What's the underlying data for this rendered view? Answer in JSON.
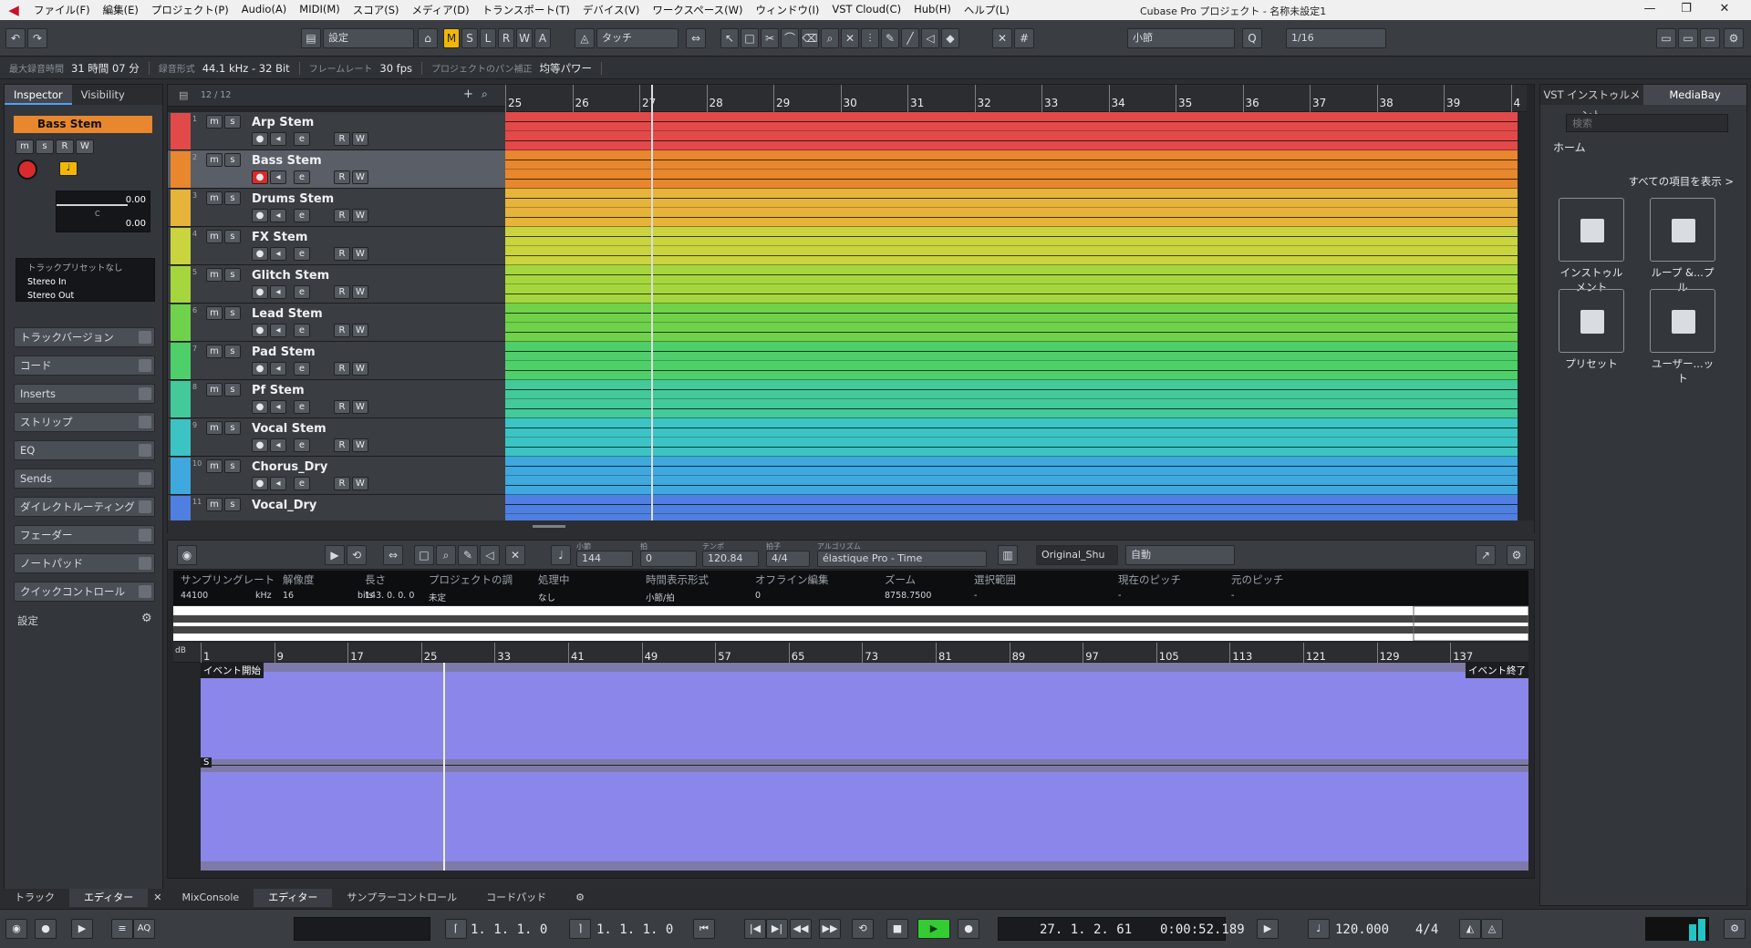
{
  "menubar": {
    "items": [
      "ファイル(F)",
      "編集(E)",
      "プロジェクト(P)",
      "Audio(A)",
      "MIDI(M)",
      "スコア(S)",
      "メディア(D)",
      "トランスポート(T)",
      "デバイス(V)",
      "ワークスペース(W)",
      "ウィンドウ(I)",
      "VST Cloud(C)",
      "Hub(H)",
      "ヘルプ(L)"
    ],
    "window_title": "Cubase Pro プロジェクト - 名称未設定1"
  },
  "toolbar": {
    "preset": "設定",
    "automation_mode": "タッチ",
    "grid_type": "小節",
    "quantize": "1/16",
    "msl": [
      "M",
      "S",
      "L",
      "R",
      "W",
      "A"
    ]
  },
  "status": {
    "rec_time_label": "最大録音時間",
    "rec_time": "31 時間 07 分",
    "rec_format_label": "録音形式",
    "rec_format": "44.1 kHz - 32 Bit",
    "frame_rate_label": "フレームレート",
    "frame_rate": "30 fps",
    "pan_label": "プロジェクトのパン補正",
    "pan": "均等パワー"
  },
  "inspector": {
    "tabs": [
      "Inspector",
      "Visibility"
    ],
    "track_number": "2",
    "track_name": "Bass Stem",
    "volume": "0.00",
    "pan": "0.00",
    "pan_center": "C",
    "track_preset": "トラックプリセットなし",
    "input": "Stereo In",
    "output": "Stereo Out",
    "sections": [
      "トラックバージョン",
      "コード",
      "Inserts",
      "ストリップ",
      "EQ",
      "Sends",
      "ダイレクトルーティング",
      "フェーダー",
      "ノートパッド",
      "クイックコントロール"
    ],
    "settings_label": "設定"
  },
  "project": {
    "track_count": "12 / 12",
    "tracks": [
      {
        "num": "1",
        "name": "Arp Stem",
        "color": "#e24a4a"
      },
      {
        "num": "2",
        "name": "Bass Stem",
        "color": "#e8872e"
      },
      {
        "num": "3",
        "name": "Drums Stem",
        "color": "#e6b43a"
      },
      {
        "num": "4",
        "name": "FX Stem",
        "color": "#c9d43e"
      },
      {
        "num": "5",
        "name": "Glitch Stem",
        "color": "#a6d63e"
      },
      {
        "num": "6",
        "name": "Lead Stem",
        "color": "#6fd24a"
      },
      {
        "num": "7",
        "name": "Pad Stem",
        "color": "#4fcf6a"
      },
      {
        "num": "8",
        "name": "Pf Stem",
        "color": "#43c99a"
      },
      {
        "num": "9",
        "name": "Vocal Stem",
        "color": "#3cc4c4"
      },
      {
        "num": "10",
        "name": "Chorus_Dry",
        "color": "#3fa8de"
      },
      {
        "num": "11",
        "name": "Vocal_Dry",
        "color": "#4f7fe0"
      }
    ],
    "ruler": [
      "25",
      "26",
      "27",
      "28",
      "29",
      "30",
      "31",
      "32",
      "33",
      "34",
      "35",
      "36",
      "37",
      "38",
      "39",
      "4"
    ],
    "track_buttons": [
      "m",
      "s",
      "R",
      "W"
    ]
  },
  "editor": {
    "bar_label": "小節",
    "bar_value": "144",
    "beat_label": "拍",
    "beat_value": "0",
    "tempo_label": "テンポ",
    "tempo_value": "120.84",
    "sig_label": "拍子",
    "sig_value": "4/4",
    "algo_label": "アルゴリズム",
    "algo_value": "élastique Pro - Time",
    "shuffle": "Original_Shu",
    "auto": "自動",
    "info_cols": [
      {
        "h": "サンプリングレート",
        "v": "44100",
        "u": "kHz"
      },
      {
        "h": "解像度",
        "v": "16",
        "u": "bits"
      },
      {
        "h": "長さ",
        "v": "143. 0. 0. 0",
        "u": ""
      },
      {
        "h": "プロジェクトの調",
        "v": "未定",
        "u": ""
      },
      {
        "h": "処理中",
        "v": "なし",
        "u": ""
      },
      {
        "h": "時間表示形式",
        "v": "小節/拍",
        "u": ""
      },
      {
        "h": "オフライン編集",
        "v": "0",
        "u": ""
      },
      {
        "h": "ズーム",
        "v": "8758.7500",
        "u": ""
      },
      {
        "h": "選択範囲",
        "v": "-",
        "u": ""
      },
      {
        "h": "現在のピッチ",
        "v": "-",
        "u": ""
      },
      {
        "h": "元のピッチ",
        "v": "-",
        "u": ""
      }
    ],
    "sample_ruler": [
      "1",
      "9",
      "17",
      "25",
      "33",
      "41",
      "49",
      "57",
      "65",
      "73",
      "81",
      "89",
      "97",
      "105",
      "113",
      "121",
      "129",
      "137"
    ],
    "db_label": "dB",
    "event_start": "イベント開始",
    "event_end": "イベント終了",
    "s_label": "S"
  },
  "bottom_tabs": {
    "left": [
      "トラック",
      "エディター"
    ],
    "right": [
      "MixConsole",
      "エディター",
      "サンプラーコントロール",
      "コードパッド"
    ]
  },
  "transport": {
    "left_locator": "1. 1. 1.   0",
    "right_locator": "1. 1. 1.   0",
    "position_bars": "27. 1. 2. 61",
    "position_time": "0:00:52.189",
    "tempo": "120.000",
    "signature": "4/4",
    "aq": "AQ"
  },
  "mediabay": {
    "tabs": [
      "VST インストゥルメント",
      "MediaBay"
    ],
    "search_placeholder": "検索",
    "home": "ホーム",
    "show_all": "すべての項目を表示 >",
    "items": [
      "インストゥルメント",
      "ループ &...プル",
      "プリセット",
      "ユーザー...ット"
    ]
  },
  "colors": {
    "accent": "#e8872e",
    "wave": "#8b86ea",
    "play": "#33cc33"
  }
}
